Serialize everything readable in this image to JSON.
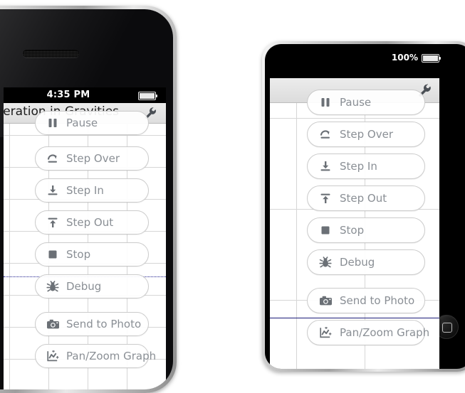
{
  "scene": {
    "description": "Two mobile device mockups showing a debugger button palette overlaying a graph view",
    "devices": [
      "iphone",
      "ipad"
    ]
  },
  "colors": {
    "button_label": "#8a8f95",
    "button_icon": "#6b7076",
    "button_border": "#cbcbcb",
    "navbar_bg": "#ececec",
    "grid_line": "#d6d6d6",
    "series_navy": "#1a1a78",
    "status_bar_bg": "#000000",
    "status_bar_text": "#ffffff"
  },
  "iphone": {
    "status_bar": {
      "clock": "4:35 PM",
      "battery_icon": "battery-full-icon"
    },
    "navbar": {
      "title": "Acceleration in Gravities",
      "action_icon": "wrench-icon"
    },
    "grid": {
      "horizontal_rows": 8,
      "vertical_columns": 4
    },
    "buttons": [
      {
        "label": "Pause",
        "icon": "pause-icon"
      },
      {
        "label": "Step Over",
        "icon": "step-over-icon"
      },
      {
        "label": "Step In",
        "icon": "step-in-icon"
      },
      {
        "label": "Step Out",
        "icon": "step-out-icon"
      },
      {
        "label": "Stop",
        "icon": "stop-icon"
      },
      {
        "label": "Debug",
        "icon": "bug-icon"
      },
      {
        "label": "Send to Photo",
        "icon": "camera-icon"
      },
      {
        "label": "Pan/Zoom Graph",
        "icon": "chart-pan-zoom-icon"
      }
    ]
  },
  "ipad": {
    "status_bar": {
      "battery_percent": "100%",
      "battery_icon": "battery-full-icon"
    },
    "navbar": {
      "title": "",
      "action_icon": "wrench-icon"
    },
    "grid": {
      "horizontal_rows": 3,
      "vertical_columns": 2
    },
    "home_button_icon": "home-button-icon",
    "buttons": [
      {
        "label": "Pause",
        "icon": "pause-icon"
      },
      {
        "label": "Step Over",
        "icon": "step-over-icon"
      },
      {
        "label": "Step In",
        "icon": "step-in-icon"
      },
      {
        "label": "Step Out",
        "icon": "step-out-icon"
      },
      {
        "label": "Stop",
        "icon": "stop-icon"
      },
      {
        "label": "Debug",
        "icon": "bug-icon"
      },
      {
        "label": "Send to Photo",
        "icon": "camera-icon"
      },
      {
        "label": "Pan/Zoom Graph",
        "icon": "chart-pan-zoom-icon"
      }
    ]
  }
}
